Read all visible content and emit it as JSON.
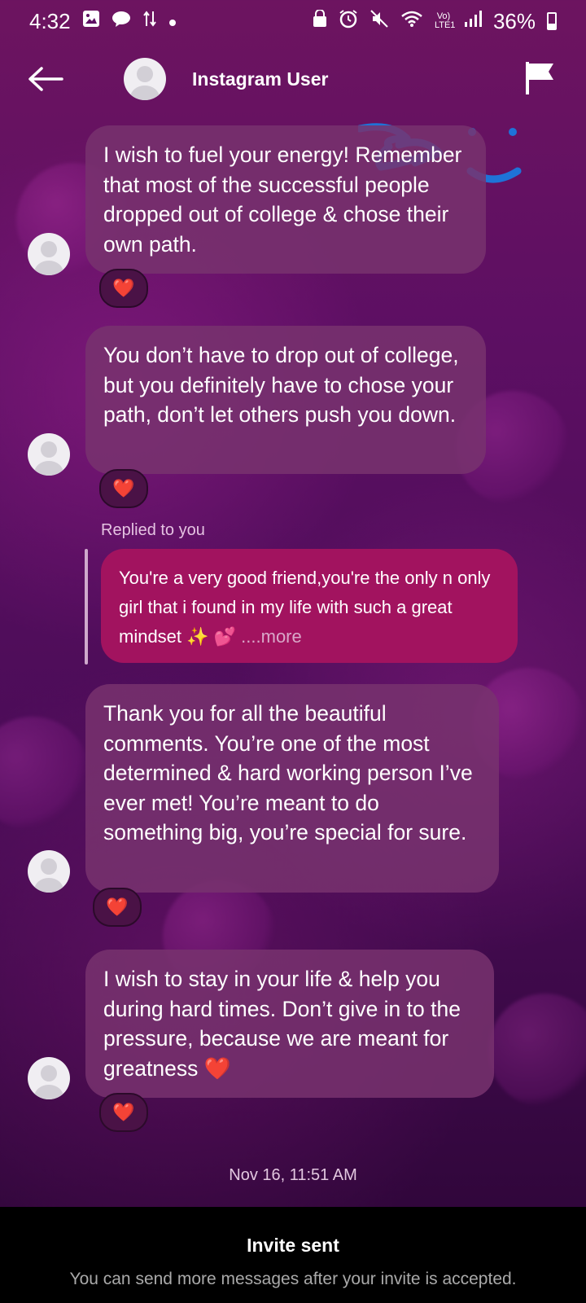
{
  "status_bar": {
    "time": "4:32",
    "battery_text": "36%",
    "icons": [
      "image-icon",
      "chat-icon",
      "data-arrows-icon",
      "dot-icon",
      "lock-icon",
      "alarm-icon",
      "mute-icon",
      "wifi-icon",
      "volte-icon",
      "signal-icon",
      "battery-icon"
    ],
    "network_label": "Vo)\nLTE1"
  },
  "header": {
    "title": "Instagram User",
    "icons": {
      "back": "back-arrow-icon",
      "flag": "flag-icon",
      "avatar": "avatar-icon"
    }
  },
  "messages": [
    {
      "text": "I wish to fuel your energy! Remember that most of the successful people dropped out of college & chose their own path.",
      "reaction": "❤️"
    },
    {
      "text": "You don’t have to drop out of college, but you definitely have to chose your path, don’t let others push you down.",
      "reaction": "❤️"
    },
    {
      "text": "Thank you for all the beautiful comments. You’re one of the most determined & hard working person I’ve ever met! You’re meant to do something big, you’re special for sure.",
      "reaction": "❤️"
    },
    {
      "text": "I wish to stay in your life & help you during hard times. Don’t give in to the pressure, because we are meant for greatness ❤️",
      "reaction": "❤️"
    }
  ],
  "reply": {
    "label": "Replied to you",
    "text": "You're a very good friend,you're the only n only girl that i found in my life with such a great mindset ✨ 💕",
    "more": "....more"
  },
  "timestamp": "Nov 16, 11:51 AM",
  "footer": {
    "title": "Invite sent",
    "subtitle": "You can send more messages after your invite is accepted."
  },
  "colors": {
    "background_top": "#6d1460",
    "background_bottom": "#2b0535",
    "bubble": "#7a326e",
    "reply_bubble": "#a2135f",
    "footer": "#000000",
    "scribble": "#1e73d8"
  }
}
